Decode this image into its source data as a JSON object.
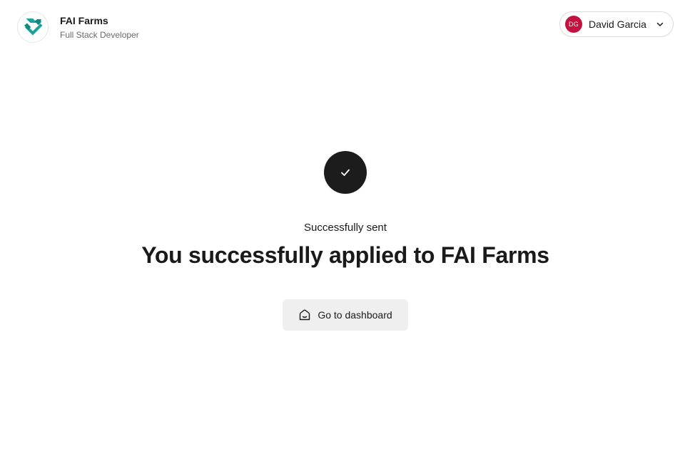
{
  "header": {
    "company_name": "FAI Farms",
    "job_title": "Full Stack Developer",
    "logo_icon": "fai-farms-logo",
    "brand_color": "#17a398"
  },
  "user_menu": {
    "initials": "DG",
    "name": "David Garcia",
    "avatar_color": "#c4123f",
    "icon": "chevron-down-icon"
  },
  "confirmation": {
    "status_icon": "checkmark-icon",
    "status_text": "Successfully sent",
    "headline": "You successfully applied to FAI Farms"
  },
  "actions": {
    "dashboard_label": "Go to dashboard",
    "dashboard_icon": "home-icon"
  }
}
